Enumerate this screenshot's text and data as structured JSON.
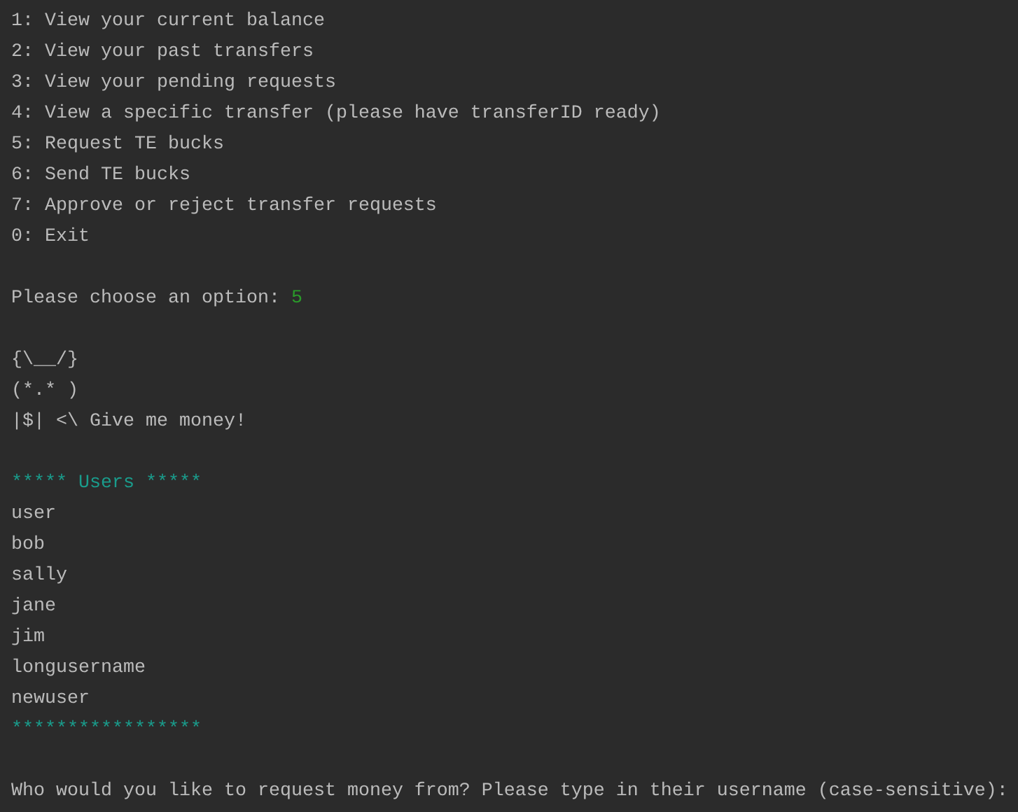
{
  "console": {
    "lines": [
      {
        "kind": "text",
        "text": "1: View your current balance"
      },
      {
        "kind": "text",
        "text": "2: View your past transfers"
      },
      {
        "kind": "text",
        "text": "3: View your pending requests"
      },
      {
        "kind": "text",
        "text": "4: View a specific transfer (please have transferID ready)"
      },
      {
        "kind": "text",
        "text": "5: Request TE bucks"
      },
      {
        "kind": "text",
        "text": "6: Send TE bucks"
      },
      {
        "kind": "text",
        "text": "7: Approve or reject transfer requests"
      },
      {
        "kind": "text",
        "text": "0: Exit"
      },
      {
        "kind": "blank"
      },
      {
        "kind": "prompt",
        "text": "Please choose an option:",
        "input": "5"
      },
      {
        "kind": "blank"
      },
      {
        "kind": "text",
        "text": "{\\__/}"
      },
      {
        "kind": "text",
        "text": "(*.* )"
      },
      {
        "kind": "text",
        "text": "|$| <\\ Give me money!"
      },
      {
        "kind": "blank"
      },
      {
        "kind": "header",
        "text": "***** Users *****"
      },
      {
        "kind": "text",
        "text": "user"
      },
      {
        "kind": "text",
        "text": "bob"
      },
      {
        "kind": "text",
        "text": "sally"
      },
      {
        "kind": "text",
        "text": "jane"
      },
      {
        "kind": "text",
        "text": "jim"
      },
      {
        "kind": "text",
        "text": "longusername"
      },
      {
        "kind": "text",
        "text": "newuser"
      },
      {
        "kind": "header",
        "text": "*****************"
      },
      {
        "kind": "blank"
      },
      {
        "kind": "text",
        "text": "Who would you like to request money from? Please type in their username (case-sensitive):"
      }
    ]
  }
}
